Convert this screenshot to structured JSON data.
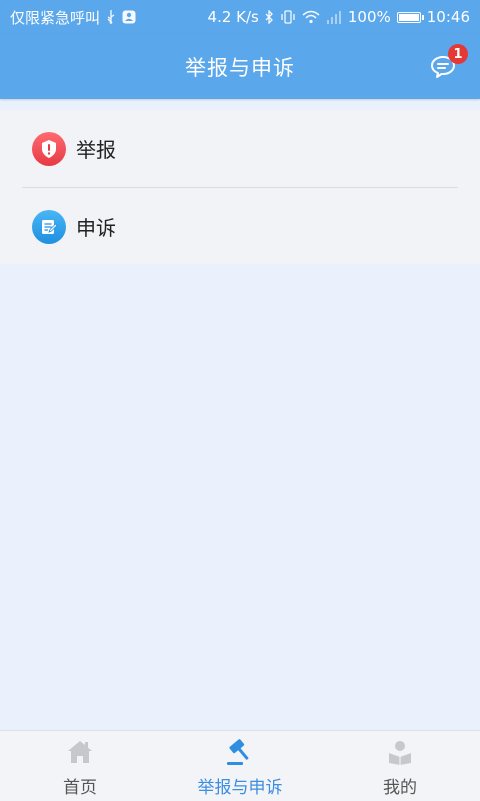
{
  "status_bar": {
    "carrier": "仅限紧急呼叫",
    "network_speed": "4.2 K/s",
    "battery": "100%",
    "battery_level": 1.0,
    "time": "10:46"
  },
  "header": {
    "title": "举报与申诉",
    "message_badge": "1",
    "background_color": "#5ba7ec",
    "badge_color": "#e53935"
  },
  "menu": {
    "items": [
      {
        "label": "举报",
        "icon": "shield-alert-icon",
        "icon_color": "#ef4f55"
      },
      {
        "label": "申诉",
        "icon": "document-edit-icon",
        "icon_color": "#33a2ea"
      }
    ]
  },
  "bottom_nav": {
    "tabs": [
      {
        "label": "首页",
        "icon": "home-icon",
        "active": false
      },
      {
        "label": "举报与申诉",
        "icon": "gavel-icon",
        "active": true
      },
      {
        "label": "我的",
        "icon": "profile-icon",
        "active": false
      }
    ],
    "active_color": "#3d8ee0",
    "inactive_color": "#555555"
  }
}
